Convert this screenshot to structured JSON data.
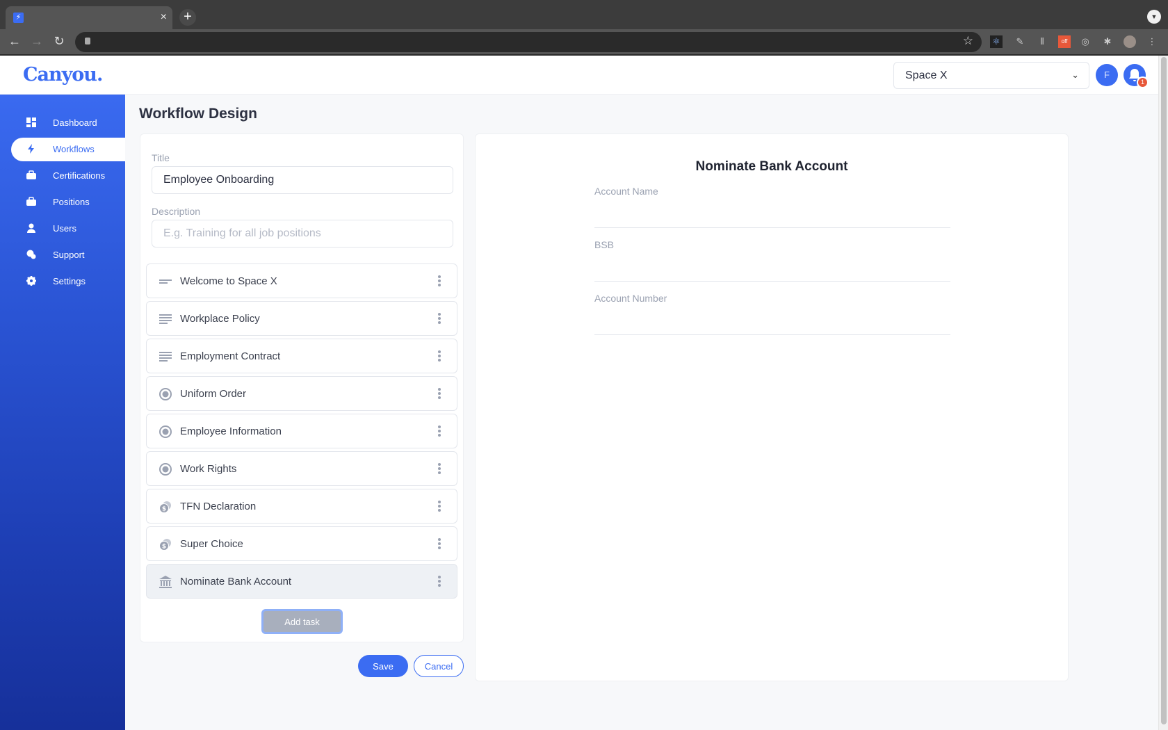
{
  "browser": {
    "new_tab_icon": "+",
    "close_tab_icon": "×",
    "extensions_off_badge": "off"
  },
  "header": {
    "logo": "Canyou.",
    "space_select": {
      "value": "Space X"
    },
    "avatar_initial": "F",
    "notification_count": "1"
  },
  "sidebar": {
    "items": [
      {
        "label": "Dashboard",
        "icon": "dashboard-icon",
        "active": false
      },
      {
        "label": "Workflows",
        "icon": "lightning-icon",
        "active": true
      },
      {
        "label": "Certifications",
        "icon": "briefcase-icon",
        "active": false
      },
      {
        "label": "Positions",
        "icon": "briefcase-icon",
        "active": false
      },
      {
        "label": "Users",
        "icon": "user-icon",
        "active": false
      },
      {
        "label": "Support",
        "icon": "chat-icon",
        "active": false
      },
      {
        "label": "Settings",
        "icon": "gear-icon",
        "active": false
      }
    ]
  },
  "main": {
    "page_title": "Workflow Design",
    "title_label": "Title",
    "title_value": "Employee Onboarding",
    "description_label": "Description",
    "description_placeholder": "E.g. Training for all job positions",
    "tasks": [
      {
        "label": "Welcome to Space X",
        "icon": "short-text-icon"
      },
      {
        "label": "Workplace Policy",
        "icon": "document-lines-icon"
      },
      {
        "label": "Employment Contract",
        "icon": "document-lines-icon"
      },
      {
        "label": "Uniform Order",
        "icon": "radio-icon"
      },
      {
        "label": "Employee Information",
        "icon": "radio-icon"
      },
      {
        "label": "Work Rights",
        "icon": "radio-icon"
      },
      {
        "label": "TFN Declaration",
        "icon": "coins-icon"
      },
      {
        "label": "Super Choice",
        "icon": "coins-icon"
      },
      {
        "label": "Nominate Bank Account",
        "icon": "bank-icon",
        "selected": true
      }
    ],
    "add_task_label": "Add task",
    "save_label": "Save",
    "cancel_label": "Cancel"
  },
  "preview": {
    "title": "Nominate Bank Account",
    "fields": [
      {
        "label": "Account Name",
        "value": ""
      },
      {
        "label": "BSB",
        "value": ""
      },
      {
        "label": "Account Number",
        "value": ""
      }
    ]
  },
  "colors": {
    "brand": "#3b6cf2",
    "badge": "#e8583a",
    "muted_text": "#9aa1b1"
  }
}
